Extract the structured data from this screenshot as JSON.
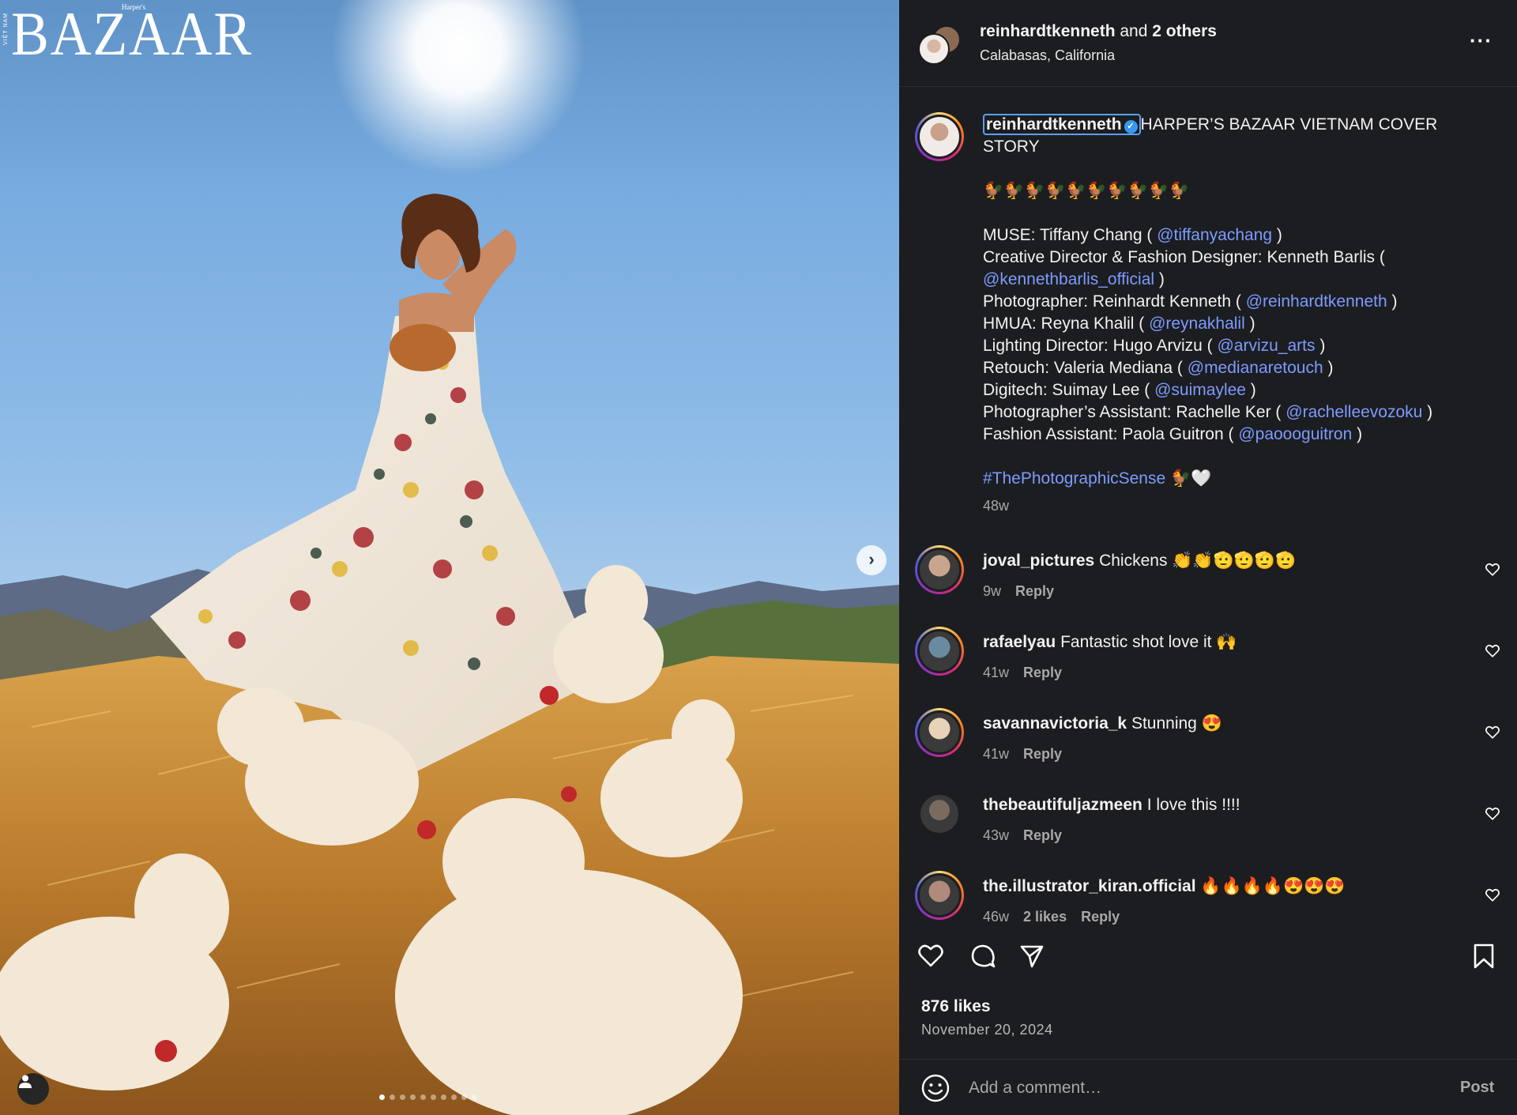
{
  "photo": {
    "logo": "BAZAAR",
    "logo_small": "Harper's",
    "logo_vertical": "VIỆT NAM"
  },
  "header": {
    "username": "reinhardtkenneth",
    "and_text": " and ",
    "others": "2 others",
    "location": "Calabasas, California",
    "more": "···"
  },
  "caption": {
    "username": "reinhardtkenneth",
    "title": "HARPER’S BAZAAR VIETNAM COVER STORY",
    "emoji_row": "🐓🐓🐓🐓🐓🐓🐓🐓🐓🐓",
    "credits": [
      {
        "label": "MUSE: Tiffany Chang ( ",
        "handle": "@tiffanyachang",
        "close": " )"
      },
      {
        "label": "Creative Director & Fashion Designer: Kenneth Barlis ( ",
        "handle": "@kennethbarlis_official",
        "close": " )"
      },
      {
        "label": "Photographer: Reinhardt Kenneth ( ",
        "handle": "@reinhardtkenneth",
        "close": " )"
      },
      {
        "label": "HMUA: Reyna Khalil ( ",
        "handle": "@reynakhalil",
        "close": " )"
      },
      {
        "label": "Lighting Director: Hugo Arvizu ( ",
        "handle": "@arvizu_arts",
        "close": " )"
      },
      {
        "label": "Retouch: Valeria Mediana ( ",
        "handle": "@medianaretouch",
        "close": " )"
      },
      {
        "label": "Digitech: Suimay Lee ( ",
        "handle": "@suimaylee",
        "close": " )"
      },
      {
        "label": "Photographer’s Assistant: Rachelle Ker ( ",
        "handle": "@rachelleevozoku",
        "close": " )"
      },
      {
        "label": "Fashion Assistant: Paola Guitron ( ",
        "handle": "@paoooguitron",
        "close": " )"
      }
    ],
    "hashtag": "#ThePhotographicSense",
    "hashtag_emoji": " 🐓🤍",
    "time": "48w"
  },
  "comments": [
    {
      "user": "joval_pictures",
      "text": " Chickens 👏👏🫡🫡🫡🫡",
      "time": "9w",
      "likes": "",
      "reply": "Reply"
    },
    {
      "user": "rafaelyau",
      "text": " Fantastic shot love it 🙌",
      "time": "41w",
      "likes": "",
      "reply": "Reply"
    },
    {
      "user": "savannavictoria_k",
      "text": " Stunning 😍",
      "time": "41w",
      "likes": "",
      "reply": "Reply"
    },
    {
      "user": "thebeautifuljazmeen",
      "text": " I love this !!!!",
      "time": "43w",
      "likes": "",
      "reply": "Reply"
    },
    {
      "user": "the.illustrator_kiran.official",
      "text": " 🔥🔥🔥🔥😍😍😍",
      "time": "46w",
      "likes": "2 likes",
      "reply": "Reply"
    }
  ],
  "footer": {
    "likes": "876 likes",
    "date": "November 20, 2024",
    "add_comment_placeholder": "Add a comment…",
    "post": "Post"
  },
  "icons": {
    "like": "heart-icon",
    "comment": "comment-icon",
    "share": "share-icon",
    "save": "bookmark-icon",
    "emoji": "emoji-icon",
    "next": "chevron-right-icon",
    "tag": "user-tag-icon"
  },
  "colors": {
    "background": "#1c1d20",
    "link": "#7d9bff",
    "muted": "#a8a8a8"
  }
}
